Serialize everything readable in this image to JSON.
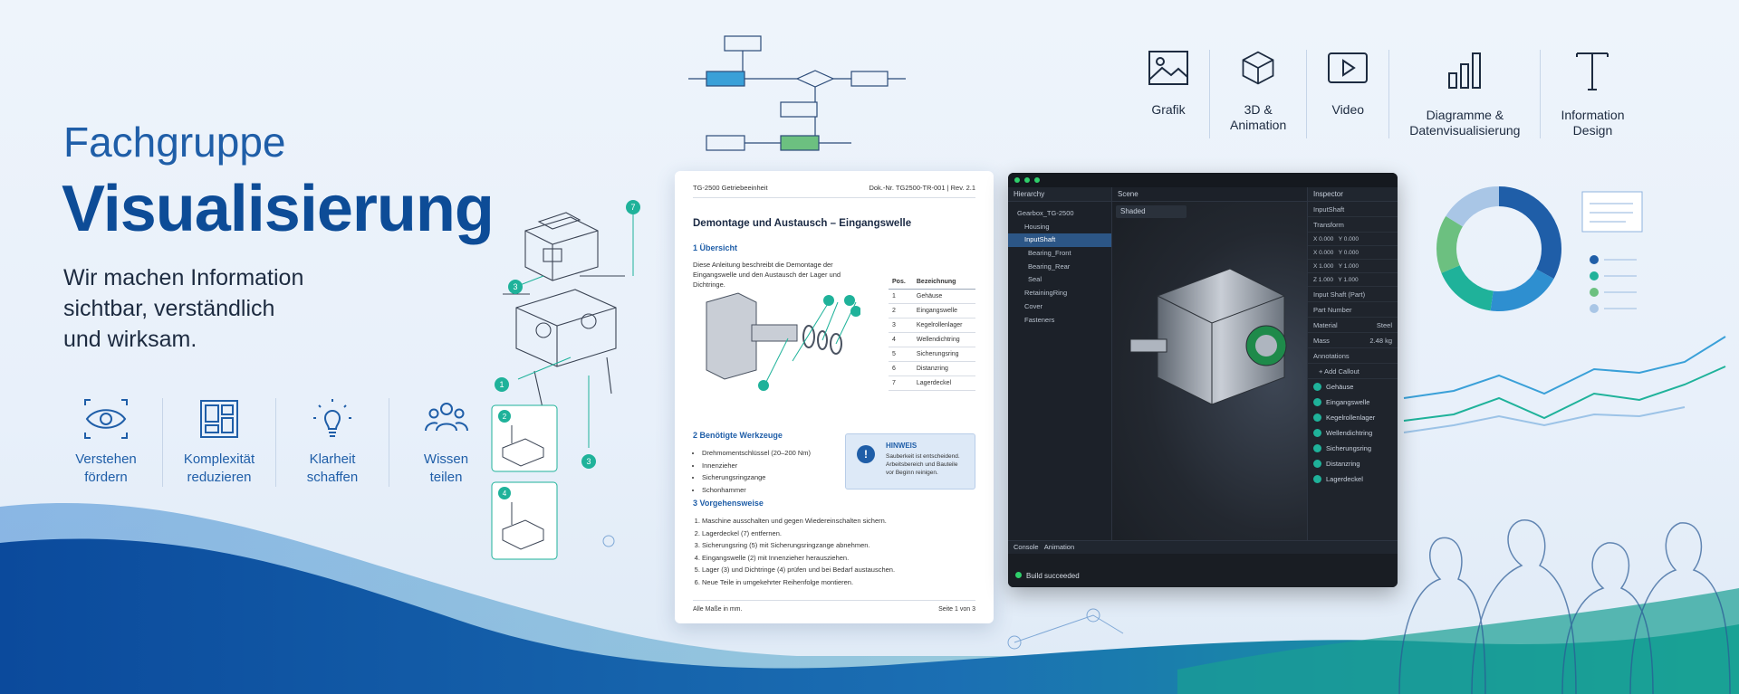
{
  "hero": {
    "kicker": "Fachgruppe",
    "title": "Visualisierung",
    "subtitle_lines": [
      "Wir machen Information",
      "sichtbar, verständlich",
      "und wirksam."
    ]
  },
  "values": [
    {
      "icon": "eye-icon",
      "line1": "Verstehen",
      "line2": "fördern"
    },
    {
      "icon": "layout-icon",
      "line1": "Komplexität",
      "line2": "reduzieren"
    },
    {
      "icon": "lightbulb-icon",
      "line1": "Klarheit",
      "line2": "schaffen"
    },
    {
      "icon": "people-icon",
      "line1": "Wissen",
      "line2": "teilen"
    }
  ],
  "top_icons": [
    {
      "icon": "image-icon",
      "line1": "Grafik",
      "line2": ""
    },
    {
      "icon": "cube-icon",
      "line1": "3D &",
      "line2": "Animation"
    },
    {
      "icon": "play-icon",
      "line1": "Video",
      "line2": ""
    },
    {
      "icon": "bar-chart-icon",
      "line1": "Diagramme &",
      "line2": "Datenvisualisierung"
    },
    {
      "icon": "text-icon",
      "line1": "Information",
      "line2": "Design"
    }
  ],
  "doc": {
    "header_left": "TG-2500 Getriebeeinheit",
    "header_right": "Dok.-Nr. TG2500-TR-001  |  Rev. 2.1",
    "title": "Demontage und Austausch – Eingangswelle",
    "s1": "1   Übersicht",
    "s1_text": "Diese Anleitung beschreibt die Demontage der Eingangswelle und den Austausch der Lager und Dichtringe.",
    "parts_head": [
      "Pos.",
      "Bezeichnung"
    ],
    "parts": [
      [
        "1",
        "Gehäuse"
      ],
      [
        "2",
        "Eingangswelle"
      ],
      [
        "3",
        "Kegelrollenlager"
      ],
      [
        "4",
        "Wellendichtring"
      ],
      [
        "5",
        "Sicherungsring"
      ],
      [
        "6",
        "Distanzring"
      ],
      [
        "7",
        "Lagerdeckel"
      ]
    ],
    "s2": "2   Benötigte Werkzeuge",
    "tools": [
      "Drehmomentschlüssel (20–200 Nm)",
      "Innenzieher",
      "Sicherungsringzange",
      "Schonhammer"
    ],
    "hint_title": "HINWEIS",
    "hint_text": "Sauberkeit ist entscheidend. Arbeitsbereich und Bauteile vor Beginn reinigen.",
    "s3": "3   Vorgehensweise",
    "steps": [
      "Maschine ausschalten und gegen Wiedereinschalten sichern.",
      "Lagerdeckel (7) entfernen.",
      "Sicherungsring (5) mit Sicherungsringzange abnehmen.",
      "Eingangswelle (2) mit Innenzieher herausziehen.",
      "Lager (3) und Dichtringe (4) prüfen und bei Bedarf austauschen.",
      "Neue Teile in umgekehrter Reihenfolge montieren."
    ],
    "footer_left": "Alle Maße in mm.",
    "footer_right": "Seite 1 von 3"
  },
  "editor": {
    "hierarchy_title": "Hierarchy",
    "scene_title": "Scene",
    "inspector_title": "Inspector",
    "shading": "Shaded",
    "tree": [
      "Gearbox_TG-2500",
      "Housing",
      "InputShaft",
      "Bearing_Front",
      "Bearing_Rear",
      "Seal",
      "RetainingRing",
      "Cover",
      "Fasteners"
    ],
    "selected": "InputShaft",
    "transform": "Transform",
    "position": [
      "X 0.000",
      "Y 0.000"
    ],
    "rotation": [
      "X 0.000",
      "Y 0.000"
    ],
    "scale": [
      "X 1.000",
      "Y 1.000"
    ],
    "scale2": [
      "Z 1.000",
      "Y 1.000"
    ],
    "part_title": "Input Shaft (Part)",
    "part_number": "Part Number",
    "material_label": "Material",
    "material_value": "Steel",
    "mass_label": "Mass",
    "mass_value": "2.48 kg",
    "annotations_title": "Annotations",
    "add_callout": "+ Add Callout",
    "annotations": [
      "Gehäuse",
      "Eingangswelle",
      "Kegelrollenlager",
      "Wellendichtring",
      "Sicherungsring",
      "Distanzring",
      "Lagerdeckel"
    ],
    "console_tab": "Console",
    "animation_tab": "Animation",
    "status": "Build succeeded"
  },
  "colors": {
    "brand": "#0d4c97",
    "accent_teal": "#1fb29a",
    "accent_green": "#6cc080",
    "donut": [
      "#1f5ea8",
      "#2e8fd0",
      "#1fb29a",
      "#6cc080",
      "#a9c6e6"
    ]
  }
}
